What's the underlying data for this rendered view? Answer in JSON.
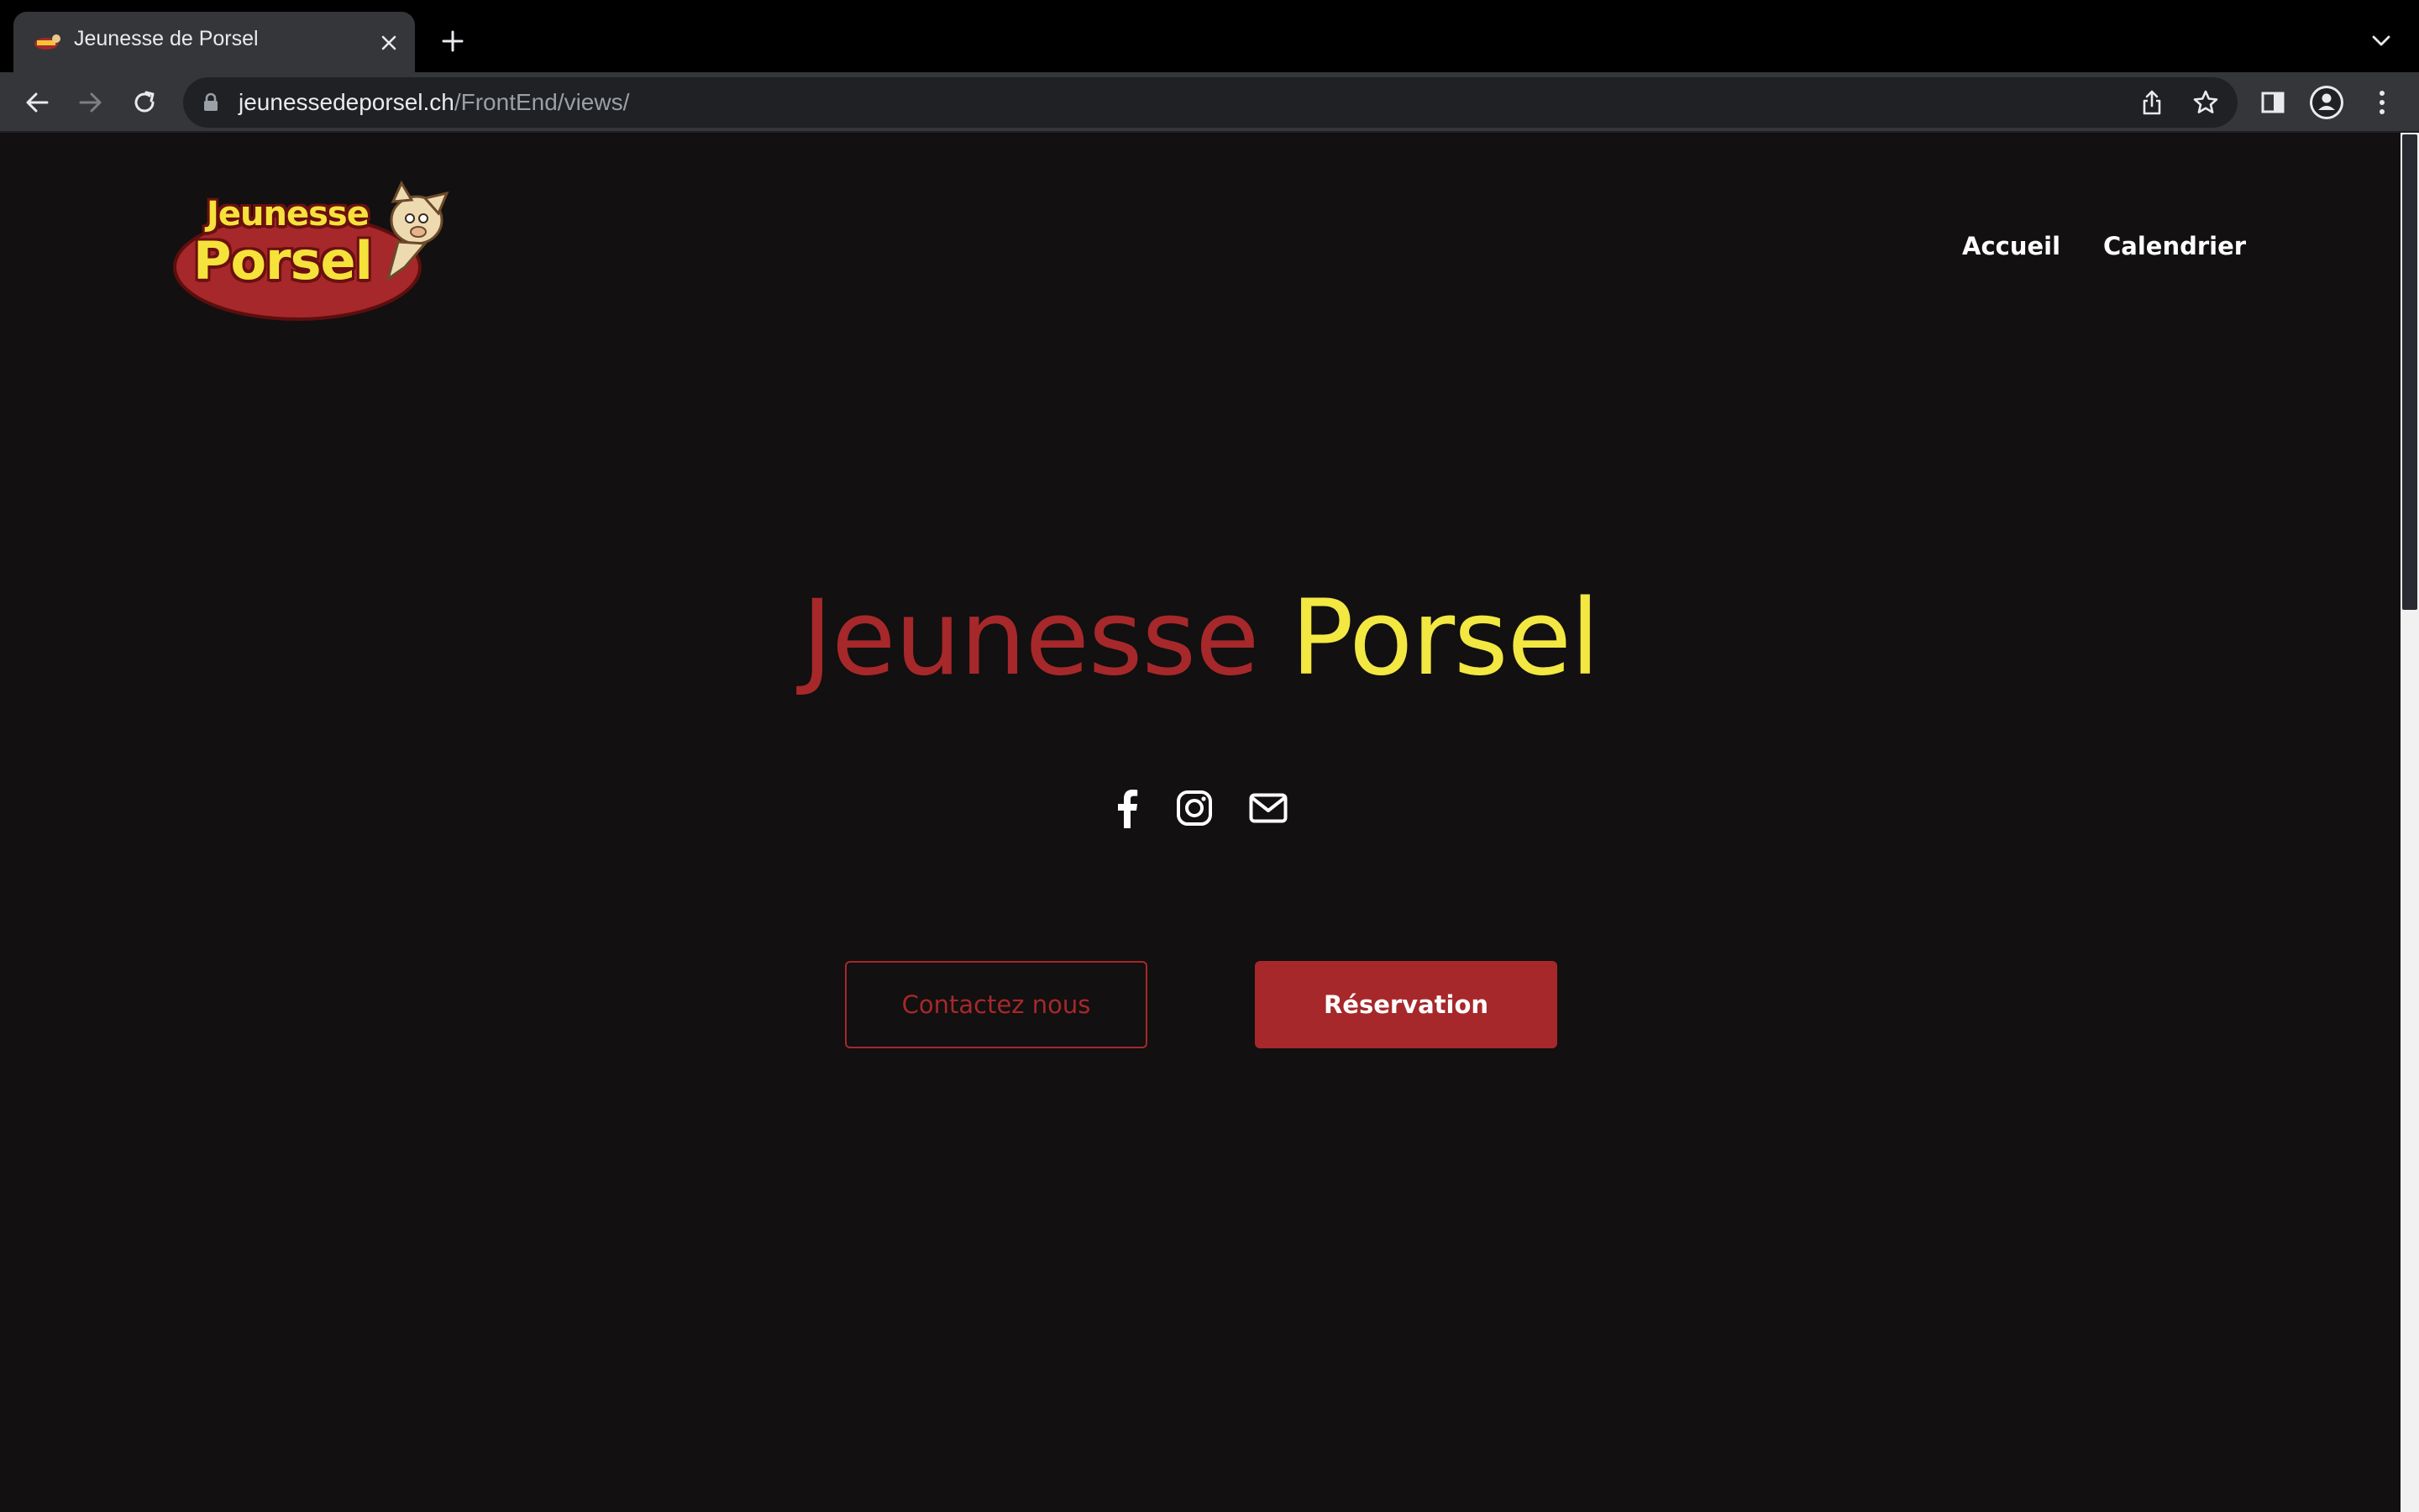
{
  "browser": {
    "tab_title": "Jeunesse de Porsel",
    "url_host": "jeunessedeporsel.ch",
    "url_path": "/FrontEnd/views/"
  },
  "site": {
    "logo": {
      "line1": "Jeunesse",
      "line2": "Porsel"
    },
    "nav": [
      "Accueil",
      "Calendrier"
    ],
    "hero": {
      "word1": "Jeunesse",
      "word2": "Porsel"
    },
    "social_icons": [
      "facebook-icon",
      "instagram-icon",
      "mail-icon"
    ],
    "buttons": {
      "contact": "Contactez nous",
      "reservation": "Réservation"
    }
  },
  "colors": {
    "page_bg": "#121010",
    "accent_red": "#a6282a",
    "accent_yellow": "#f3e742",
    "text_white": "#ffffff"
  }
}
